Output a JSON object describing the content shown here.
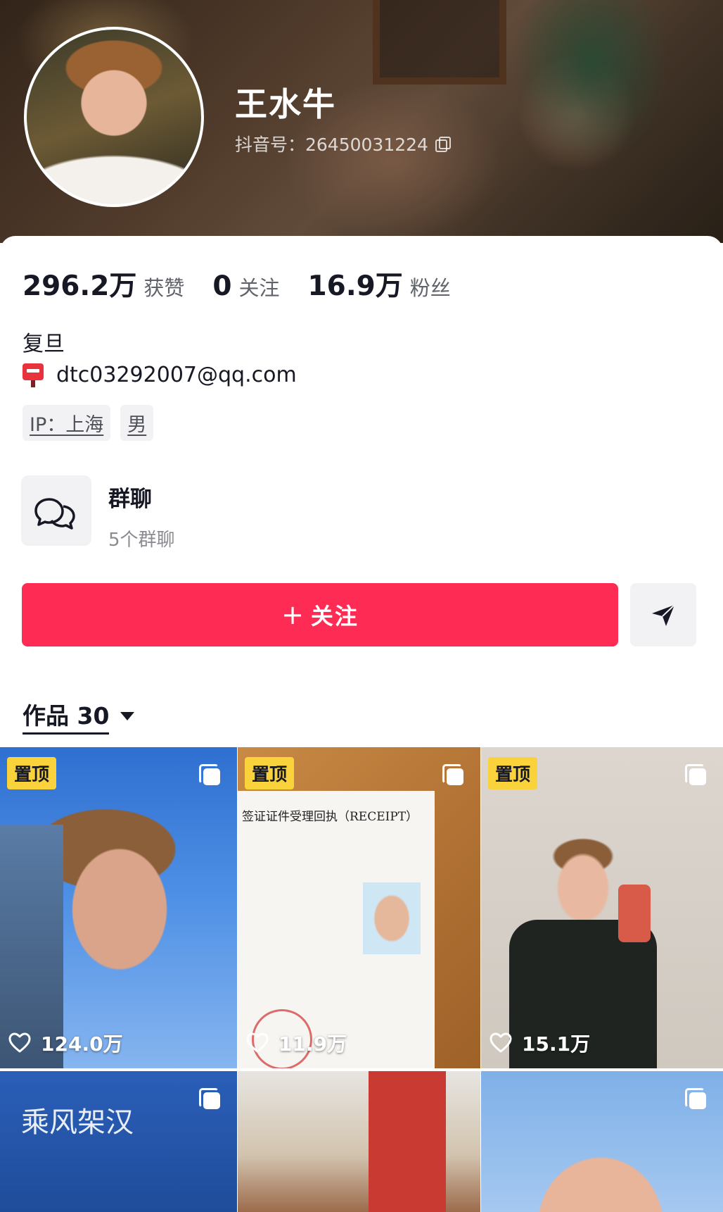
{
  "profile": {
    "name": "王水牛",
    "douyin_id": "抖音号：26450031224"
  },
  "stats": [
    {
      "value": "296.2万",
      "label": "获赞"
    },
    {
      "value": "0",
      "label": "关注"
    },
    {
      "value": "16.9万",
      "label": "粉丝"
    }
  ],
  "bio": {
    "school": "复旦",
    "email": "dtc03292007@qq.com"
  },
  "tags": {
    "ip": "IP：上海",
    "gender": "男"
  },
  "group_chat": {
    "title": "群聊",
    "subtitle": "5个群聊"
  },
  "actions": {
    "follow_plus": "+",
    "follow_label": "关注"
  },
  "works": {
    "label": "作品 30"
  },
  "grid": {
    "pin_label": "置顶",
    "items": [
      {
        "likes": "124.0万",
        "pinned": true
      },
      {
        "likes": "11.9万",
        "pinned": true,
        "doc_header": "签证证件受理回执（RECEIPT）"
      },
      {
        "likes": "15.1万",
        "pinned": true
      },
      {
        "pinned": false,
        "banner": "乘风架汉"
      },
      {
        "pinned": false
      },
      {
        "pinned": false
      }
    ]
  },
  "icons": {
    "copy": "copy-icon",
    "mailbox": "mailbox-icon",
    "group": "chat-bubbles-icon",
    "share": "send-arrow-icon",
    "like": "heart-outline-icon",
    "multi": "multi-image-icon",
    "caret": "caret-down-icon"
  },
  "colors": {
    "accent": "#fe2c55",
    "pin": "#fad23b"
  }
}
